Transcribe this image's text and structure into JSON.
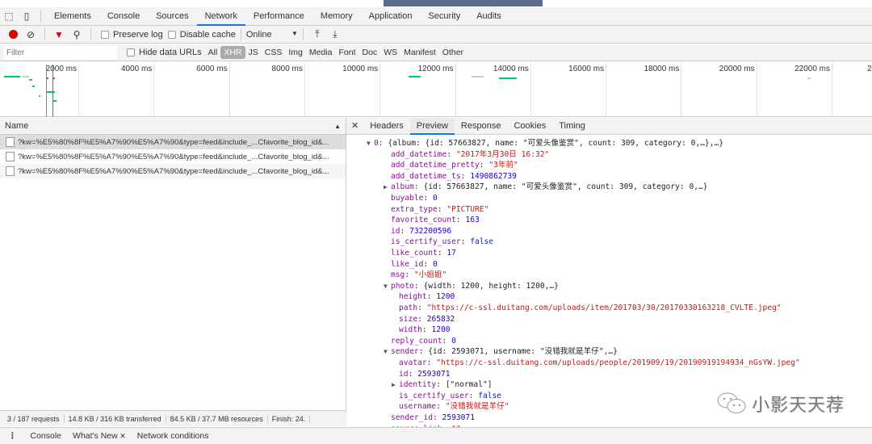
{
  "devtools_tabs": [
    "Elements",
    "Console",
    "Sources",
    "Network",
    "Performance",
    "Memory",
    "Application",
    "Security",
    "Audits"
  ],
  "active_tab": "Network",
  "toolbar": {
    "preserve_log": "Preserve log",
    "disable_cache": "Disable cache",
    "throttle": "Online",
    "record_color": "#e00000",
    "filter_color": "#d0021b"
  },
  "filter": {
    "placeholder": "Filter",
    "hide_data_urls": "Hide data URLs",
    "types": [
      "All",
      "XHR",
      "JS",
      "CSS",
      "Img",
      "Media",
      "Font",
      "Doc",
      "WS",
      "Manifest",
      "Other"
    ],
    "active_type": "XHR"
  },
  "timeline": {
    "ticks": [
      "2000 ms",
      "4000 ms",
      "6000 ms",
      "8000 ms",
      "10000 ms",
      "12000 ms",
      "14000 ms",
      "16000 ms",
      "18000 ms",
      "20000 ms",
      "22000 ms",
      "2"
    ]
  },
  "requests": {
    "header": "Name",
    "rows": [
      "?kw=%E5%80%8F%E5%A7%90%E5%A7%90&type=feed&include_...Cfavorite_blog_id&...",
      "?kw=%E5%80%8F%E5%A7%90%E5%A7%90&type=feed&include_...Cfavorite_blog_id&...",
      "?kw=%E5%80%8F%E5%A7%90%E5%A7%90&type=feed&include_...Cfavorite_blog_id&..."
    ]
  },
  "detail_tabs": [
    "Headers",
    "Preview",
    "Response",
    "Cookies",
    "Timing"
  ],
  "active_detail_tab": "Preview",
  "preview": [
    {
      "lvl": 0,
      "arrow": "down",
      "k": "0",
      "v": "{album: {id: 57663827, name: \"可爱头像鉴赏\", count: 309, category: 0,…},…}",
      "t": "obj"
    },
    {
      "lvl": 1,
      "k": "add_datetime",
      "v": "\"2017年3月30日 16:32\"",
      "t": "str"
    },
    {
      "lvl": 1,
      "k": "add_datetime_pretty",
      "v": "\"3年前\"",
      "t": "str"
    },
    {
      "lvl": 1,
      "k": "add_datetime_ts",
      "v": "1490862739",
      "t": "num"
    },
    {
      "lvl": 1,
      "arrow": "right",
      "k": "album",
      "v": "{id: 57663827, name: \"可爱头像鉴赏\", count: 309, category: 0,…}",
      "t": "obj"
    },
    {
      "lvl": 1,
      "k": "buyable",
      "v": "0",
      "t": "num"
    },
    {
      "lvl": 1,
      "k": "extra_type",
      "v": "\"PICTURE\"",
      "t": "str"
    },
    {
      "lvl": 1,
      "k": "favorite_count",
      "v": "163",
      "t": "num"
    },
    {
      "lvl": 1,
      "k": "id",
      "v": "732200596",
      "t": "num"
    },
    {
      "lvl": 1,
      "k": "is_certify_user",
      "v": "false",
      "t": "bool"
    },
    {
      "lvl": 1,
      "k": "like_count",
      "v": "17",
      "t": "num"
    },
    {
      "lvl": 1,
      "k": "like_id",
      "v": "0",
      "t": "num"
    },
    {
      "lvl": 1,
      "k": "msg",
      "v": "\"小姐姐\"",
      "t": "str"
    },
    {
      "lvl": 1,
      "arrow": "down",
      "k": "photo",
      "v": "{width: 1200, height: 1200,…}",
      "t": "obj"
    },
    {
      "lvl": 2,
      "k": "height",
      "v": "1200",
      "t": "num"
    },
    {
      "lvl": 2,
      "k": "path",
      "v": "\"https://c-ssl.duitang.com/uploads/item/201703/30/20170330163218_CVLTE.jpeg\"",
      "t": "str"
    },
    {
      "lvl": 2,
      "k": "size",
      "v": "265832",
      "t": "num"
    },
    {
      "lvl": 2,
      "k": "width",
      "v": "1200",
      "t": "num"
    },
    {
      "lvl": 1,
      "k": "reply_count",
      "v": "0",
      "t": "num"
    },
    {
      "lvl": 1,
      "arrow": "down",
      "k": "sender",
      "v": "{id: 2593071, username: \"没错我就是羊仔\",…}",
      "t": "obj"
    },
    {
      "lvl": 2,
      "k": "avatar",
      "v": "\"https://c-ssl.duitang.com/uploads/people/201909/19/20190919194934_nGsYW.jpeg\"",
      "t": "str"
    },
    {
      "lvl": 2,
      "k": "id",
      "v": "2593071",
      "t": "num"
    },
    {
      "lvl": 2,
      "arrow": "right",
      "k": "identity",
      "v": "[\"normal\"]",
      "t": "obj"
    },
    {
      "lvl": 2,
      "k": "is_certify_user",
      "v": "false",
      "t": "bool"
    },
    {
      "lvl": 2,
      "k": "username",
      "v": "\"没错我就是羊仔\"",
      "t": "str"
    },
    {
      "lvl": 1,
      "k": "sender_id",
      "v": "2593071",
      "t": "num"
    },
    {
      "lvl": 1,
      "k": "source_link",
      "v": "\"\"",
      "t": "str"
    }
  ],
  "status": [
    "3 / 187 requests",
    "14.8 KB / 316 KB transferred",
    "84.5 KB / 37.7 MB resources",
    "Finish: 24."
  ],
  "drawer": {
    "tabs": [
      "Console",
      "What's New",
      "Network conditions"
    ]
  },
  "watermark": "小影天天荐"
}
